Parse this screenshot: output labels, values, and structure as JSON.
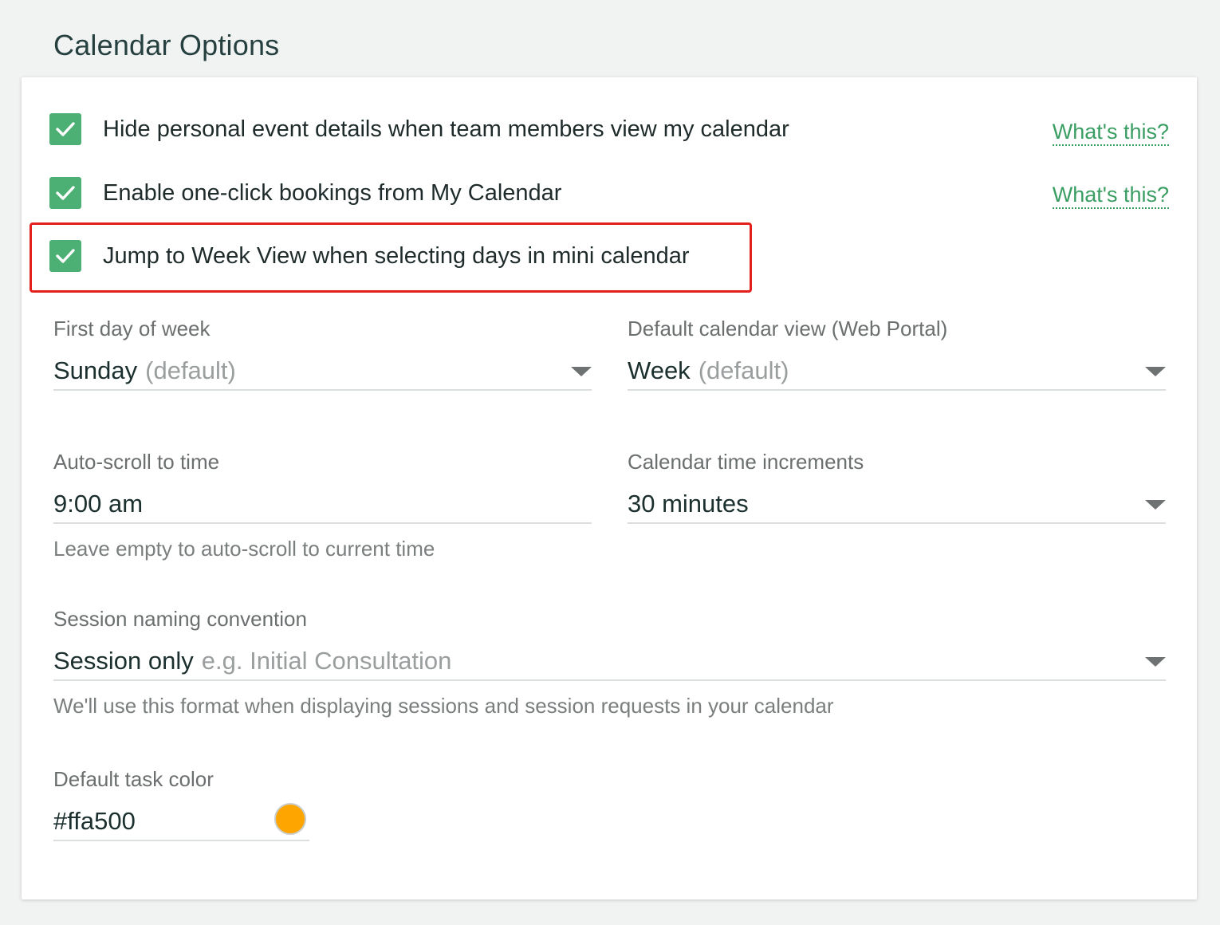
{
  "page": {
    "title": "Calendar Options"
  },
  "options": [
    {
      "label": "Hide personal event details when team members view my calendar",
      "checked": true,
      "help_link": "What's this?"
    },
    {
      "label": "Enable one-click bookings from My Calendar",
      "checked": true,
      "help_link": "What's this?"
    },
    {
      "label": "Jump to Week View when selecting days in mini calendar",
      "checked": true,
      "help_link": ""
    }
  ],
  "fields": {
    "first_day": {
      "label": "First day of week",
      "value": "Sunday",
      "hint": "(default)"
    },
    "default_view": {
      "label": "Default calendar view (Web Portal)",
      "value": "Week",
      "hint": "(default)"
    },
    "auto_scroll": {
      "label": "Auto-scroll to time",
      "value": "9:00 am",
      "helper": "Leave empty to auto-scroll to current time"
    },
    "time_increments": {
      "label": "Calendar time increments",
      "value": "30 minutes"
    },
    "session_naming": {
      "label": "Session naming convention",
      "value": "Session only",
      "hint": "e.g. Initial Consultation",
      "helper": "We'll use this format when displaying sessions and session requests in your calendar"
    },
    "task_color": {
      "label": "Default task color",
      "value": "#ffa500"
    }
  },
  "colors": {
    "accent": "#4caf74",
    "link": "#3a9e63",
    "highlight": "#e3201b",
    "task_color": "#ffa500"
  }
}
